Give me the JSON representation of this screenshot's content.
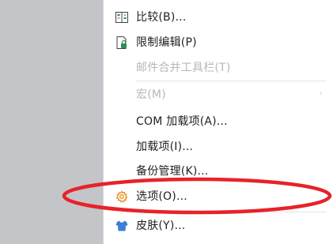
{
  "menu": {
    "items": [
      {
        "label": "比较(B)...",
        "icon": "compare-icon",
        "enabled": true
      },
      {
        "label": "限制编辑(P)",
        "icon": "restrict-editing-lock-icon",
        "enabled": true
      },
      {
        "label": "邮件合并工具栏(T)",
        "icon": "",
        "enabled": false
      },
      {
        "label": "宏(M)",
        "icon": "",
        "enabled": false,
        "submenu": true
      },
      {
        "label": "COM 加载项(A)...",
        "icon": "",
        "enabled": true
      },
      {
        "label": "加载项(I)...",
        "icon": "",
        "enabled": true
      },
      {
        "label": "备份管理(K)...",
        "icon": "",
        "enabled": true
      },
      {
        "label": "选项(O)...",
        "icon": "options-gear-icon",
        "enabled": true,
        "highlighted": true
      },
      {
        "label": "皮肤(Y)...",
        "icon": "skin-shirt-icon",
        "enabled": true
      }
    ],
    "submenu_arrow": "›"
  },
  "colors": {
    "background": "#c3c5c9",
    "menu_bg": "#ffffff",
    "text": "#222222",
    "disabled_text": "#b8b8b8",
    "highlight_ring": "#e8222a",
    "gear": "#e8912a",
    "shirt": "#3d7fd6"
  }
}
